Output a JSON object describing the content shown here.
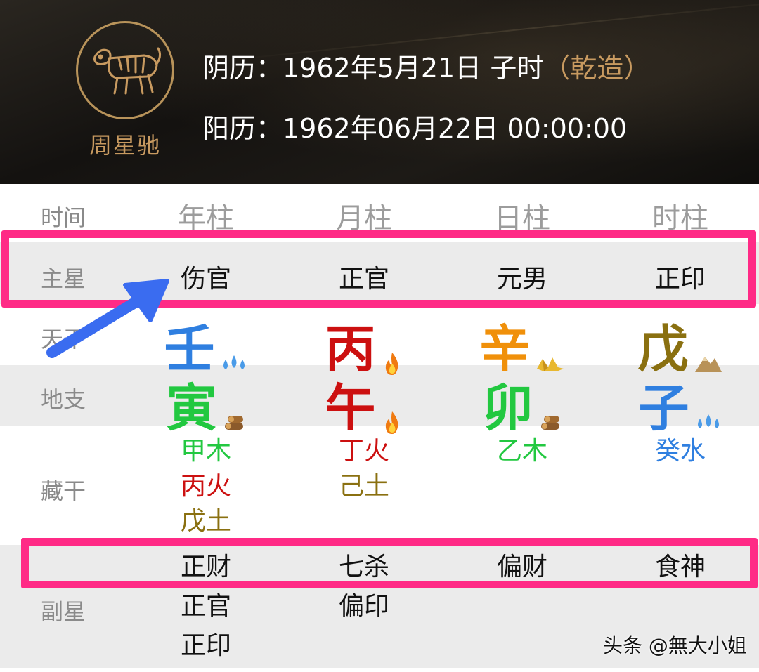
{
  "header": {
    "avatar_name": "周星驰",
    "lunar_prefix": "阴历：1962年5月21日 子时",
    "lunar_gender": "（乾造）",
    "solar": "阳历：1962年06月22日 00:00:00"
  },
  "table": {
    "time_label": "时间",
    "columns": [
      "年柱",
      "月柱",
      "日柱",
      "时柱"
    ],
    "main_star": {
      "label": "主星",
      "values": [
        "伤官",
        "正官",
        "元男",
        "正印"
      ]
    },
    "tiangan": {
      "label": "天干",
      "chars": [
        "壬",
        "丙",
        "辛",
        "戊"
      ],
      "colors": [
        "#2f7fe0",
        "#cc1010",
        "#f0900a",
        "#8a7010"
      ],
      "icons": [
        "water-drops-icon",
        "fire-icon",
        "gold-ingot-icon",
        "mountain-icon"
      ]
    },
    "dizhi": {
      "label": "地支",
      "chars": [
        "寅",
        "午",
        "卯",
        "子"
      ],
      "colors": [
        "#22c840",
        "#cc1010",
        "#22c840",
        "#2f7fe0"
      ],
      "icons": [
        "wood-logs-icon",
        "fire-icon",
        "wood-logs-icon",
        "water-drops-icon"
      ]
    },
    "canggan": {
      "label": "藏干",
      "columns": [
        [
          "甲木",
          "丙火",
          "戊土"
        ],
        [
          "丁火",
          "己土"
        ],
        [
          "乙木"
        ],
        [
          "癸水"
        ]
      ]
    },
    "fuxing": {
      "label": "副星",
      "columns": [
        [
          "正财",
          "正官",
          "正印"
        ],
        [
          "七杀",
          "偏印"
        ],
        [
          "偏财"
        ],
        [
          "食神"
        ]
      ]
    }
  },
  "watermark": "头条 @無大小姐",
  "colors": {
    "highlight": "#ff2a86",
    "arrow": "#3a6cf0",
    "gold": "#c89a60",
    "wood": "#22c840",
    "fire": "#cc1010",
    "earth": "#8a7010",
    "water": "#2f7fe0"
  }
}
